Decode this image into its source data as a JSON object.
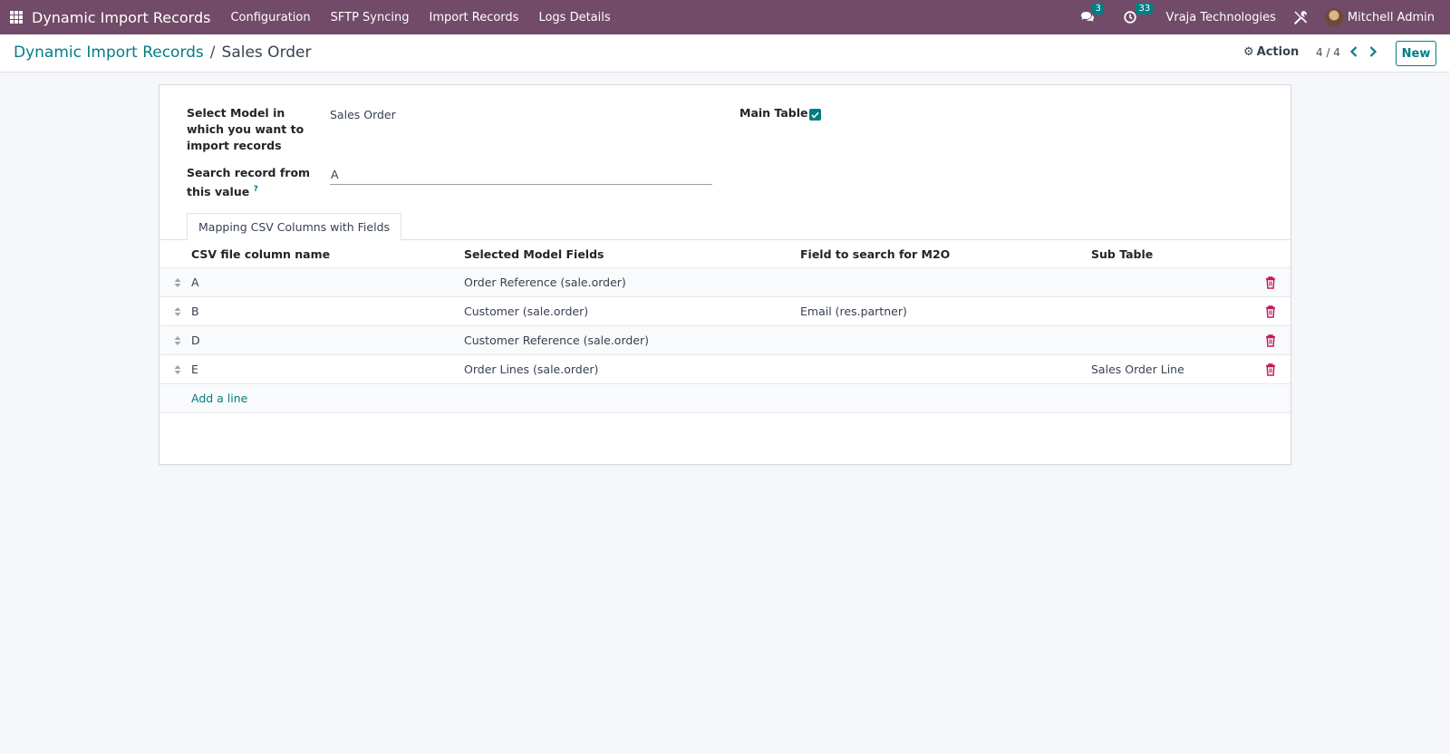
{
  "navbar": {
    "app_name": "Dynamic Import Records",
    "menu": [
      "Configuration",
      "SFTP Syncing",
      "Import Records",
      "Logs Details"
    ],
    "messages_count": "3",
    "activities_count": "33",
    "company": "Vraja Technologies",
    "user": "Mitchell Admin"
  },
  "breadcrumb": {
    "parent": "Dynamic Import Records",
    "separator": "/",
    "current": "Sales Order"
  },
  "toolbar": {
    "action_label": "Action",
    "pager": "4 / 4",
    "new_label": "New"
  },
  "form": {
    "model_label": "Select Model in which you want to import records",
    "model_value": "Sales Order",
    "search_label": "Search record from this value",
    "search_help": "?",
    "search_value": "A",
    "main_table_label": "Main Table",
    "main_table_checked": true
  },
  "tabs": [
    "Mapping CSV Columns with Fields"
  ],
  "table": {
    "headers": [
      "CSV file column name",
      "Selected Model Fields",
      "Field to search for M2O",
      "Sub Table"
    ],
    "rows": [
      {
        "csv": "A",
        "field": "Order Reference (sale.order)",
        "m2o": "",
        "sub": ""
      },
      {
        "csv": "B",
        "field": "Customer (sale.order)",
        "m2o": "Email (res.partner)",
        "sub": ""
      },
      {
        "csv": "D",
        "field": "Customer Reference (sale.order)",
        "m2o": "",
        "sub": ""
      },
      {
        "csv": "E",
        "field": "Order Lines (sale.order)",
        "m2o": "",
        "sub": "Sales Order Line"
      }
    ],
    "add_line_label": "Add a line"
  },
  "colors": {
    "navbar": "#714b67",
    "accent": "#017e84"
  }
}
